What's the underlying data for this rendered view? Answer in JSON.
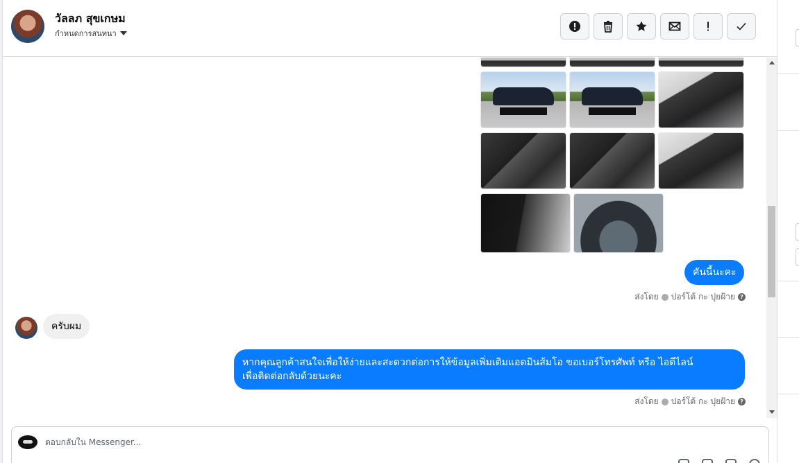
{
  "header": {
    "contact_name": "วัลลภ สุขเกษม",
    "conversation_settings_label": "กำหนดการสนทนา",
    "toolbar": [
      {
        "name": "info-button",
        "icon": "alert-circle-icon",
        "glyph": "!"
      },
      {
        "name": "delete-button",
        "icon": "trash-icon"
      },
      {
        "name": "star-button",
        "icon": "star-icon"
      },
      {
        "name": "mark-unread-button",
        "icon": "envelope-icon"
      },
      {
        "name": "spam-button",
        "icon": "exclamation-icon",
        "glyph": "!"
      },
      {
        "name": "mark-done-button",
        "icon": "check-icon"
      }
    ]
  },
  "messages": [
    {
      "direction": "out",
      "type": "photos",
      "count": 14
    },
    {
      "direction": "out",
      "type": "text",
      "text": "คันนี้นะคะ",
      "sent_by_label": "ส่งโดย",
      "sender": "ปอร์โต้ กะ ปุยฝ้าย"
    },
    {
      "direction": "in",
      "type": "text",
      "text": "ครับผม"
    },
    {
      "direction": "out",
      "type": "text",
      "lines": [
        "หากคุณลูกค้าสนใจเพื่อให้ง่ายและสะดวกต่อการให้ข้อมูลเพิ่มเติมแอดมินส้มโอ ขอเบอร์โทรศัพท์ หรือ ไอดีไลน์",
        "เพื่อติดต่อกลับด้วยนะคะ"
      ],
      "sent_by_label": "ส่งโดย",
      "sender": "ปอร์โต้ กะ ปุยฝ้าย"
    }
  ],
  "composer": {
    "placeholder": "ตอบกลับใน Messenger..."
  },
  "colors": {
    "outgoing_bubble": "#0a7cff",
    "incoming_bubble": "#f0f0f0",
    "meta_text": "#65676b"
  }
}
